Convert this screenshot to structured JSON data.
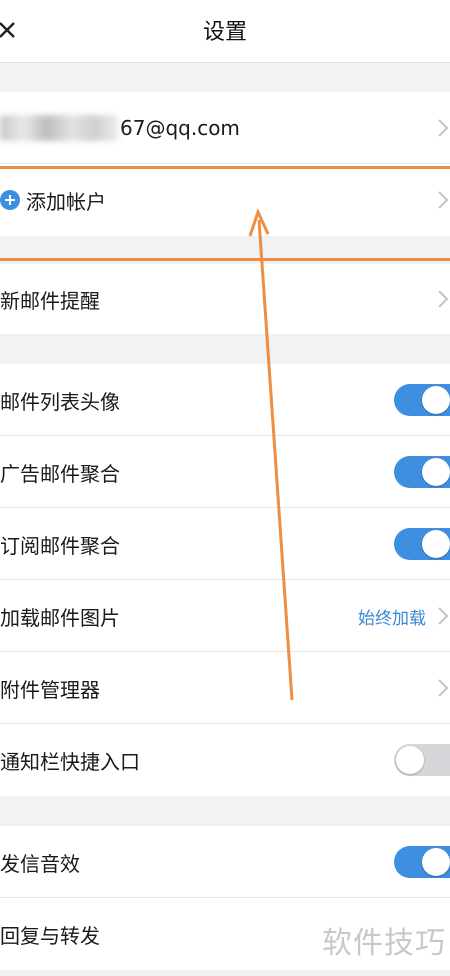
{
  "header": {
    "title": "设置",
    "close_icon": "close-icon"
  },
  "account": {
    "email_visible": "67@qq.com",
    "add_account_label": "添加帐户"
  },
  "notifications": {
    "new_mail_alert_label": "新邮件提醒"
  },
  "settings": [
    {
      "label": "邮件列表头像",
      "type": "toggle",
      "on": true
    },
    {
      "label": "广告邮件聚合",
      "type": "toggle",
      "on": true
    },
    {
      "label": "订阅邮件聚合",
      "type": "toggle",
      "on": true
    },
    {
      "label": "加载邮件图片",
      "type": "value",
      "value": "始终加载"
    },
    {
      "label": "附件管理器",
      "type": "chevron"
    },
    {
      "label": "通知栏快捷入口",
      "type": "toggle",
      "on": false
    }
  ],
  "sound": [
    {
      "label": "发信音效",
      "type": "toggle",
      "on": true
    },
    {
      "label": "回复与转发",
      "type": "chevron"
    }
  ],
  "watermark": "软件技巧",
  "colors": {
    "accent": "#3f8fe0",
    "highlight": "#ef8e43",
    "toggle_off": "#d6d6da"
  }
}
